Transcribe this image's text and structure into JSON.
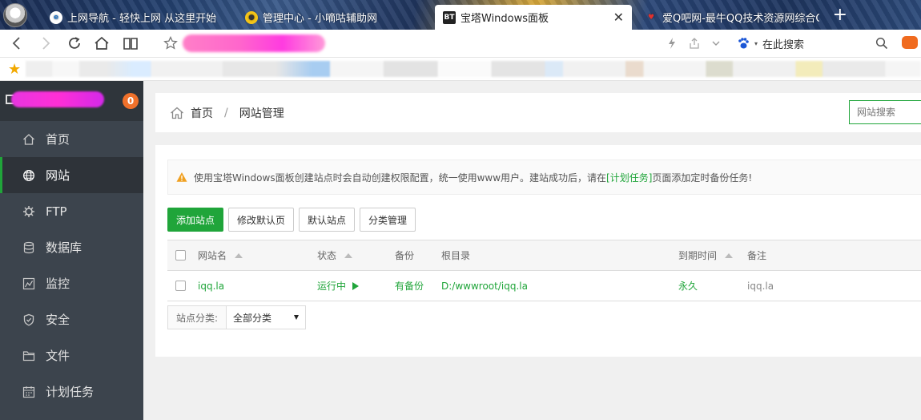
{
  "browser": {
    "tabs": [
      {
        "label": "上网导航 - 轻快上网 从这里开始",
        "icon": "ie-icon",
        "active": false
      },
      {
        "label": "管理中心 - 小嘀咕辅助网",
        "icon": "qq-icon",
        "active": false
      },
      {
        "label": "宝塔Windows面板",
        "icon": "bt-icon",
        "active": true
      },
      {
        "label": "爱Q吧网-最牛QQ技术资源网综合Q",
        "icon": "heart-icon",
        "active": false
      }
    ],
    "bt_favicon_text": "BT",
    "close_glyph": "✕",
    "new_tab_glyph": "+",
    "search_placeholder": "在此搜索"
  },
  "sidebar": {
    "badge": "0",
    "items": [
      {
        "label": "首页",
        "icon": "home-icon"
      },
      {
        "label": "网站",
        "icon": "globe-icon",
        "active": true
      },
      {
        "label": "FTP",
        "icon": "ftp-icon"
      },
      {
        "label": "数据库",
        "icon": "database-icon"
      },
      {
        "label": "监控",
        "icon": "monitor-chart-icon"
      },
      {
        "label": "安全",
        "icon": "shield-icon"
      },
      {
        "label": "文件",
        "icon": "folder-icon"
      },
      {
        "label": "计划任务",
        "icon": "calendar-icon"
      }
    ]
  },
  "breadcrumb": {
    "home": "首页",
    "separator": "/",
    "current": "网站管理"
  },
  "site_search_placeholder": "网站搜索",
  "notice": {
    "text_before": "使用宝塔Windows面板创建站点时会自动创建权限配置，统一使用www用户。建站成功后，请在",
    "link": "[计划任务]",
    "text_after": "页面添加定时备份任务!"
  },
  "toolbar": {
    "add_site": "添加站点",
    "modify_default_page": "修改默认页",
    "default_site": "默认站点",
    "category_manage": "分类管理"
  },
  "table": {
    "headers": {
      "name": "网站名",
      "status": "状态",
      "backup": "备份",
      "root": "根目录",
      "expire": "到期时间",
      "remark": "备注"
    },
    "rows": [
      {
        "name": "iqq.la",
        "status": "运行中",
        "backup": "有备份",
        "root": "D:/wwwroot/iqq.la",
        "expire": "永久",
        "remark": "iqq.la"
      }
    ]
  },
  "category": {
    "label": "站点分类:",
    "selected": "全部分类"
  },
  "colors": {
    "accent": "#20a53a",
    "sidebar": "#3c444d",
    "badge": "#f0712b"
  }
}
